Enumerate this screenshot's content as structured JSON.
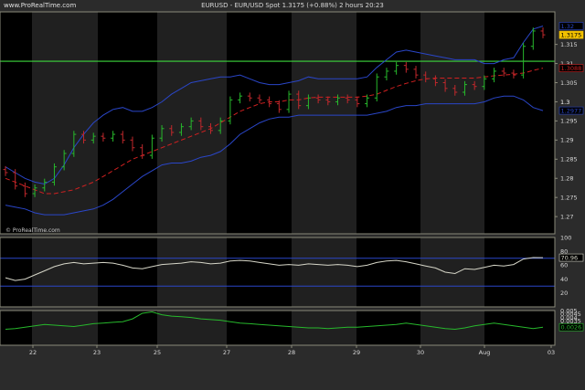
{
  "header": {
    "site": "www.ProRealTime.com",
    "title": "EURUSD - EUR/USD Spot   1.3175 (+0.88%)   2 hours  20:23"
  },
  "watermark": "© ProRealTime.com",
  "colors": {
    "background": "#000000",
    "band_dark": "#000000",
    "band_light": "#3a3a3a",
    "candle_up": "#27b82c",
    "candle_down": "#c0282c",
    "bollinger": "#2a46c8",
    "moving_average": "#d02020",
    "horizontal_line": "#3cd83c",
    "oscillator": "#d6d6c8",
    "lower_indicator": "#27b82c",
    "rsi_levels": "#2a46c8",
    "axis_text": "#d8d8d8"
  },
  "chart_data": [
    {
      "type": "line",
      "panel": "price",
      "chart_style": "candlestick",
      "ylim": [
        1.2655,
        1.3235
      ],
      "y_ticks": [
        "1.315",
        "1.31",
        "1.305",
        "1.3",
        "1.295",
        "1.29",
        "1.285",
        "1.28",
        "1.275",
        "1.27"
      ],
      "y_tick_values": [
        1.315,
        1.31,
        1.305,
        1.3,
        1.295,
        1.29,
        1.285,
        1.28,
        1.275,
        1.27
      ],
      "last_price_label": "1.3175",
      "last_price_value": 1.3175,
      "upper_band_label": "1.32",
      "upper_band_value": 1.3198,
      "ma_label": "1.3088",
      "ma_value": 1.3088,
      "lower_band_label": "1.2977",
      "lower_band_value": 1.2977,
      "horizontal_line_value": 1.3106,
      "x_ticks": [
        "22",
        "23",
        "25",
        "27",
        "28",
        "29",
        "30",
        "Aug",
        "03"
      ],
      "close": [
        1.2815,
        1.278,
        1.276,
        1.2775,
        1.279,
        1.283,
        1.2865,
        1.2915,
        1.29,
        1.291,
        1.2905,
        1.2915,
        1.29,
        1.288,
        1.286,
        1.2905,
        1.293,
        1.292,
        1.2935,
        1.295,
        1.2935,
        1.2925,
        1.295,
        1.3005,
        1.3015,
        1.301,
        1.3005,
        1.2995,
        1.298,
        1.302,
        1.299,
        1.301,
        1.3005,
        1.3,
        1.301,
        1.3005,
        1.2995,
        1.301,
        1.3065,
        1.308,
        1.3095,
        1.3085,
        1.307,
        1.306,
        1.305,
        1.3035,
        1.3025,
        1.3045,
        1.304,
        1.306,
        1.308,
        1.3075,
        1.307,
        1.3145,
        1.3185,
        1.3175
      ],
      "upper_band": [
        1.283,
        1.2815,
        1.28,
        1.279,
        1.2785,
        1.28,
        1.2835,
        1.288,
        1.2915,
        1.2945,
        1.2965,
        1.298,
        1.2985,
        1.2975,
        1.2975,
        1.2985,
        1.3,
        1.302,
        1.3035,
        1.305,
        1.3055,
        1.306,
        1.3065,
        1.3065,
        1.307,
        1.306,
        1.305,
        1.3045,
        1.3045,
        1.305,
        1.3055,
        1.3065,
        1.306,
        1.306,
        1.306,
        1.306,
        1.306,
        1.3065,
        1.309,
        1.311,
        1.313,
        1.3135,
        1.313,
        1.3125,
        1.312,
        1.3115,
        1.311,
        1.311,
        1.311,
        1.31,
        1.31,
        1.311,
        1.3115,
        1.3155,
        1.319,
        1.3198
      ],
      "lower_band": [
        1.273,
        1.2725,
        1.272,
        1.271,
        1.2705,
        1.2705,
        1.2705,
        1.271,
        1.2715,
        1.272,
        1.273,
        1.2745,
        1.2765,
        1.2785,
        1.2805,
        1.282,
        1.2835,
        1.284,
        1.284,
        1.2845,
        1.2855,
        1.286,
        1.287,
        1.289,
        1.2915,
        1.293,
        1.2945,
        1.2955,
        1.296,
        1.296,
        1.2965,
        1.2965,
        1.2965,
        1.2965,
        1.2965,
        1.2965,
        1.2965,
        1.2965,
        1.297,
        1.2975,
        1.2985,
        1.299,
        1.299,
        1.2995,
        1.2995,
        1.2995,
        1.2995,
        1.2995,
        1.2995,
        1.3,
        1.301,
        1.3015,
        1.3015,
        1.3005,
        1.2985,
        1.2977
      ],
      "moving_average": [
        1.28,
        1.279,
        1.278,
        1.277,
        1.276,
        1.276,
        1.2765,
        1.277,
        1.278,
        1.279,
        1.2805,
        1.282,
        1.2835,
        1.285,
        1.286,
        1.287,
        1.288,
        1.289,
        1.29,
        1.291,
        1.292,
        1.293,
        1.2945,
        1.296,
        1.2975,
        1.2985,
        1.2995,
        1.3,
        1.3,
        1.3005,
        1.3005,
        1.301,
        1.3012,
        1.3012,
        1.3012,
        1.3012,
        1.3012,
        1.3015,
        1.302,
        1.303,
        1.304,
        1.3048,
        1.3055,
        1.306,
        1.3062,
        1.3062,
        1.3062,
        1.3062,
        1.3062,
        1.3065,
        1.3068,
        1.307,
        1.3072,
        1.3075,
        1.3082,
        1.3088
      ]
    },
    {
      "type": "line",
      "panel": "oscillator",
      "ylim": [
        0,
        100
      ],
      "y_ticks": [
        "100",
        "80",
        "60",
        "40",
        "20"
      ],
      "y_tick_values": [
        100,
        80,
        60,
        40,
        20
      ],
      "levels": [
        70,
        30
      ],
      "last_value_label": "70.96",
      "last_value": 70.96,
      "values": [
        42,
        38,
        40,
        46,
        52,
        58,
        62,
        64,
        62,
        63,
        64,
        63,
        60,
        56,
        55,
        58,
        61,
        62,
        63,
        65,
        64,
        62,
        63,
        66,
        67,
        66,
        64,
        62,
        60,
        61,
        60,
        62,
        61,
        60,
        61,
        60,
        58,
        60,
        64,
        66,
        67,
        65,
        62,
        59,
        56,
        50,
        48,
        55,
        54,
        57,
        60,
        59,
        61,
        69,
        71,
        70.96
      ]
    },
    {
      "type": "line",
      "panel": "lower",
      "ylim": [
        0,
        0.005
      ],
      "y_ticks": [
        "0.005",
        "0.0045",
        "0.004",
        "0.0035",
        "0.003",
        "0.0025"
      ],
      "y_tick_values": [
        0.005,
        0.0045,
        0.004,
        0.0035,
        0.003,
        0.0025
      ],
      "last_value_label": "0.0026",
      "last_value": 0.0026,
      "values": [
        0.0023,
        0.0024,
        0.0026,
        0.0028,
        0.003,
        0.0029,
        0.0028,
        0.0027,
        0.0029,
        0.0031,
        0.0032,
        0.0033,
        0.0034,
        0.0038,
        0.0046,
        0.0048,
        0.0044,
        0.0042,
        0.0041,
        0.004,
        0.0038,
        0.0037,
        0.0036,
        0.0034,
        0.0032,
        0.0031,
        0.003,
        0.0029,
        0.0028,
        0.0027,
        0.0026,
        0.0025,
        0.0025,
        0.0024,
        0.0025,
        0.0026,
        0.0026,
        0.0027,
        0.0028,
        0.0029,
        0.003,
        0.0032,
        0.003,
        0.0028,
        0.0026,
        0.0024,
        0.0023,
        0.0025,
        0.0028,
        0.003,
        0.0032,
        0.003,
        0.0028,
        0.0026,
        0.0024,
        0.0026
      ]
    }
  ]
}
